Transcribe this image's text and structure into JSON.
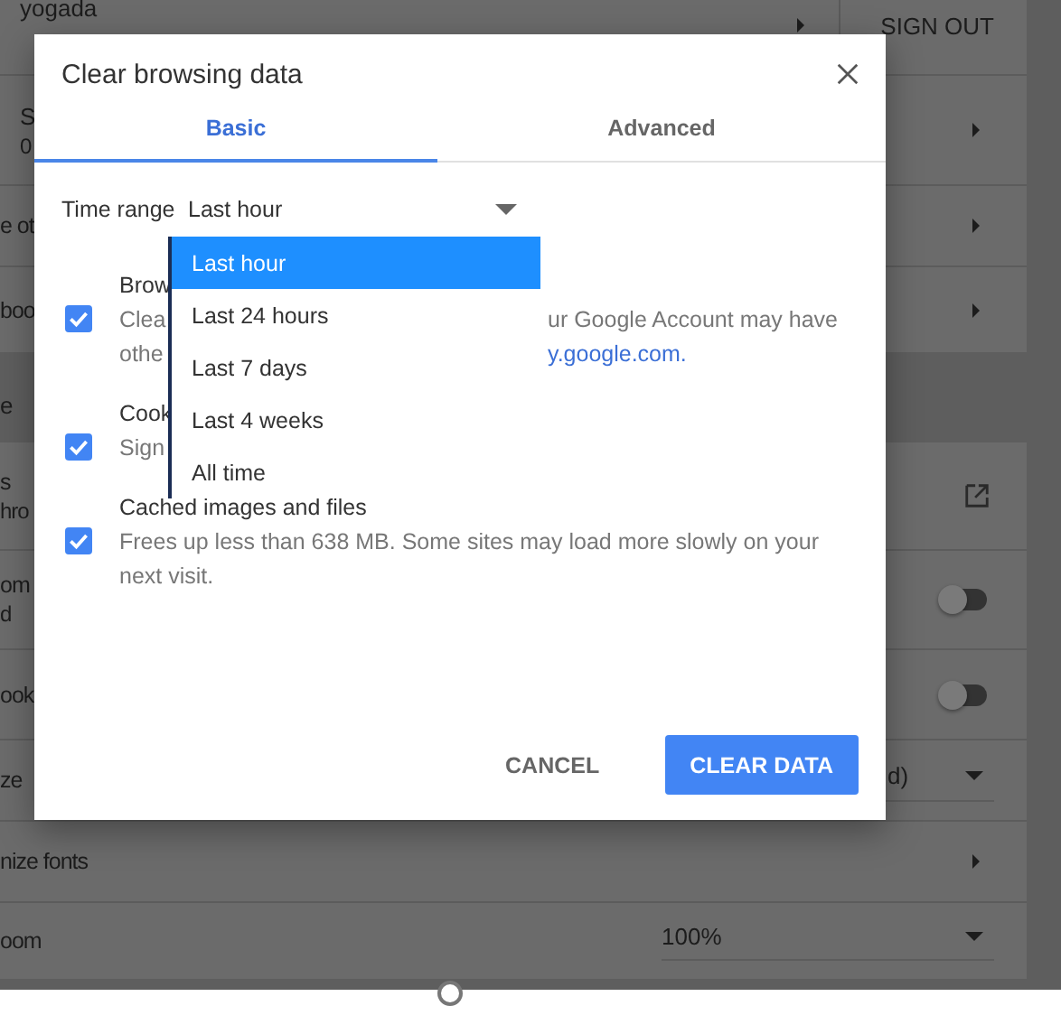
{
  "background": {
    "cards": [
      {
        "rows": [
          {
            "kind": "account",
            "lines": [
              "yogada"
            ],
            "action": "SIGN OUT"
          },
          {
            "kind": "account",
            "lines": [
              "S",
              "0"
            ]
          },
          {
            "kind": "arrow",
            "lines": [
              "e ot"
            ]
          },
          {
            "kind": "arrow",
            "lines": [
              "boo"
            ]
          }
        ]
      },
      {
        "header": "e",
        "rows": [
          {
            "kind": "link",
            "lines": [
              "s",
              "hro"
            ]
          },
          {
            "kind": "toggle",
            "lines": [
              "om",
              "d"
            ],
            "on": false
          },
          {
            "kind": "toggle",
            "lines": [
              "ook"
            ],
            "on": false
          },
          {
            "kind": "select-partial",
            "lines": [
              "ze"
            ],
            "value": "d)"
          },
          {
            "kind": "arrow",
            "lines": [
              "nize fonts"
            ]
          },
          {
            "kind": "select",
            "lines": [
              "oom"
            ],
            "value": "100%"
          }
        ]
      }
    ]
  },
  "dialog": {
    "title": "Clear browsing data",
    "tabs": [
      {
        "label": "Basic",
        "selected": true
      },
      {
        "label": "Advanced",
        "selected": false
      }
    ],
    "time_range": {
      "label": "Time range",
      "value": "Last hour",
      "menu": [
        {
          "label": "Last hour",
          "selected": true
        },
        {
          "label": "Last 24 hours",
          "selected": false
        },
        {
          "label": "Last 7 days",
          "selected": false
        },
        {
          "label": "Last 4 weeks",
          "selected": false
        },
        {
          "label": "All time",
          "selected": false
        }
      ]
    },
    "items": [
      {
        "checked": true,
        "title": "Brow",
        "lines": [
          {
            "kind": "text",
            "left": "Clea",
            "right": "ur Google Account may have"
          },
          {
            "kind": "link",
            "left": "othe",
            "right": "y.google.com."
          }
        ]
      },
      {
        "checked": true,
        "title": "Cook",
        "lines": [
          {
            "kind": "text",
            "left": "Sign"
          }
        ]
      },
      {
        "checked": true,
        "title": "Cached images and files",
        "description": "Frees up less than 638 MB. Some sites may load more slowly on your next visit."
      }
    ],
    "buttons": [
      {
        "label": "CANCEL",
        "kind": "text"
      },
      {
        "label": "CLEAR DATA",
        "kind": "primary"
      }
    ]
  }
}
